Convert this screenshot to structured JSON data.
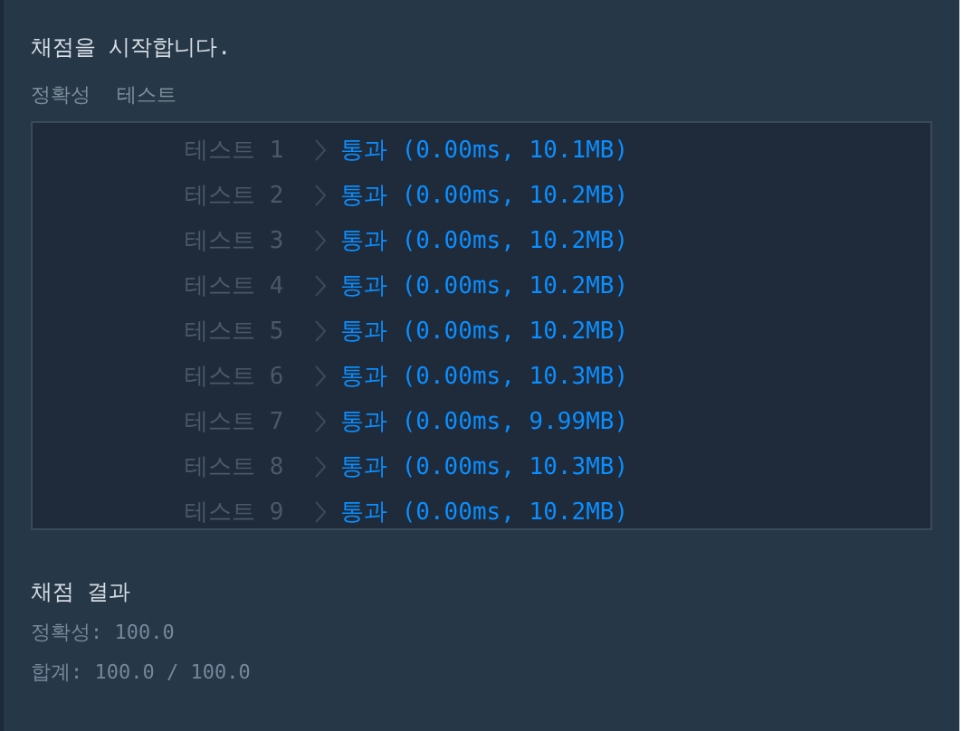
{
  "header": "채점을 시작합니다.",
  "section_title": "정확성 테스트",
  "tests": [
    {
      "label": "테스트 1",
      "result": "통과 (0.00ms, 10.1MB)"
    },
    {
      "label": "테스트 2",
      "result": "통과 (0.00ms, 10.2MB)"
    },
    {
      "label": "테스트 3",
      "result": "통과 (0.00ms, 10.2MB)"
    },
    {
      "label": "테스트 4",
      "result": "통과 (0.00ms, 10.2MB)"
    },
    {
      "label": "테스트 5",
      "result": "통과 (0.00ms, 10.2MB)"
    },
    {
      "label": "테스트 6",
      "result": "통과 (0.00ms, 10.3MB)"
    },
    {
      "label": "테스트 7",
      "result": "통과 (0.00ms, 9.99MB)"
    },
    {
      "label": "테스트 8",
      "result": "통과 (0.00ms, 10.3MB)"
    },
    {
      "label": "테스트 9",
      "result": "통과 (0.00ms, 10.2MB)"
    }
  ],
  "summary_title": "채점 결과",
  "summary_lines": [
    "정확성: 100.0",
    "합계: 100.0 / 100.0"
  ]
}
